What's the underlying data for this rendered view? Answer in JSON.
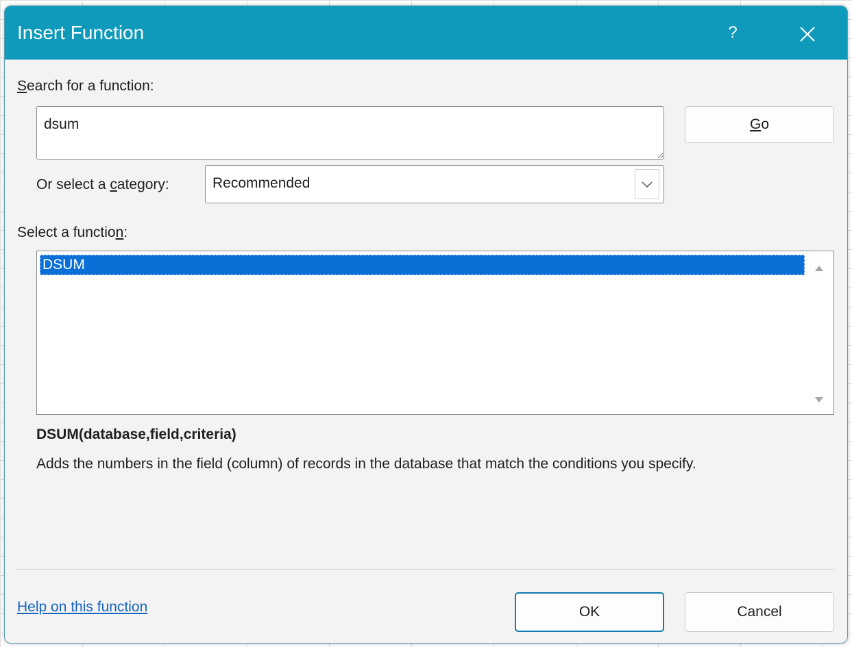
{
  "dialog": {
    "title": "Insert Function",
    "help_symbol": "?",
    "close_icon": "close-icon"
  },
  "search": {
    "label_prefix": "",
    "label_accel": "S",
    "label_rest": "earch for a function:",
    "value": "dsum",
    "go_button": {
      "accel": "G",
      "rest": "o"
    }
  },
  "category": {
    "label_prefix": "Or select a ",
    "label_accel": "c",
    "label_rest": "ategory:",
    "selected": "Recommended"
  },
  "function_list": {
    "label_prefix": "Select a functio",
    "label_accel": "n",
    "label_rest": ":",
    "items": [
      "DSUM"
    ],
    "selected_index": 0
  },
  "details": {
    "signature": "DSUM(database,field,criteria)",
    "description": "Adds the numbers in the field (column) of records in the database that match the conditions you specify."
  },
  "footer": {
    "help_link": "Help on this function",
    "ok": "OK",
    "cancel": "Cancel"
  },
  "colors": {
    "titlebar": "#0f99ba",
    "selection": "#0a6fd6",
    "link": "#1565c0"
  }
}
